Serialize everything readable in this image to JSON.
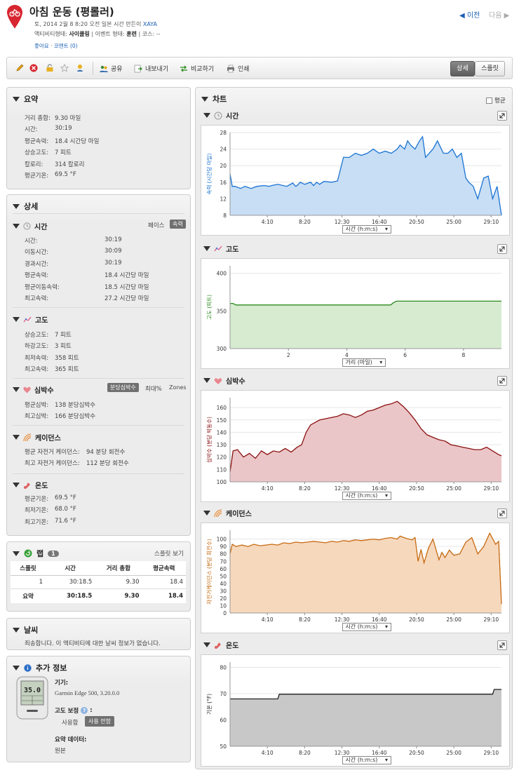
{
  "header": {
    "title": "아침 운동 (평롤러)",
    "date_line": "토, 2014 2월 8 8:20 오전 일본 시간 만든이",
    "author": "XAYA",
    "activity_type_label": "액티비티형태:",
    "activity_type": "사이클링",
    "event_type_label": "이벤트 형태:",
    "event_type": "훈련",
    "course_label": "코스:",
    "course": "--",
    "like": "좋아요",
    "comment": "코멘트 (0)",
    "prev": "이전",
    "next": "다음"
  },
  "toolbar": {
    "share": "공유",
    "export": "내보내기",
    "compare": "비교하기",
    "print": "인쇄",
    "detail": "상세",
    "split": "스플릿"
  },
  "summary": {
    "title": "요약",
    "rows": [
      {
        "label": "거리 총합:",
        "value": "9.30 마일"
      },
      {
        "label": "시간:",
        "value": "30:19"
      },
      {
        "label": "평균속력:",
        "value": "18.4 시간당 마일"
      },
      {
        "label": "상승고도:",
        "value": "7 피트"
      },
      {
        "label": "칼로리:",
        "value": "314 칼로리"
      },
      {
        "label": "평균기온:",
        "value": "69.5 °F"
      }
    ]
  },
  "details": {
    "title": "상세",
    "time": {
      "title": "시간",
      "pace": "페이스",
      "speed": "속력",
      "rows": [
        {
          "label": "시간:",
          "value": "30:19"
        },
        {
          "label": "이동시간:",
          "value": "30:09"
        },
        {
          "label": "경과시간:",
          "value": "30:19"
        },
        {
          "label": "평균속력:",
          "value": "18.4 시간당 마일"
        },
        {
          "label": "평균이동속력:",
          "value": "18.5 시간당 마일"
        },
        {
          "label": "최고속력:",
          "value": "27.2 시간당 마일"
        }
      ]
    },
    "elev": {
      "title": "고도",
      "rows": [
        {
          "label": "상승고도:",
          "value": "7 피트"
        },
        {
          "label": "하강고도:",
          "value": "3 피트"
        },
        {
          "label": "최저속력:",
          "value": "358 피트"
        },
        {
          "label": "최고속력:",
          "value": "365 피트"
        }
      ]
    },
    "hr": {
      "title": "심박수",
      "bpm": "분당심박수",
      "max": "최대%",
      "zones": "Zones",
      "rows": [
        {
          "label": "평균심박:",
          "value": "138 분당심박수"
        },
        {
          "label": "최고심박:",
          "value": "166 분당심박수"
        }
      ]
    },
    "cad": {
      "title": "케이던스",
      "rows": [
        {
          "label": "평균 자전거 케이던스:",
          "value": "94 분당 회전수"
        },
        {
          "label": "최고 자전거 케이던스:",
          "value": "112 분당 회전수"
        }
      ]
    },
    "temp": {
      "title": "온도",
      "rows": [
        {
          "label": "평균기온:",
          "value": "69.5 °F"
        },
        {
          "label": "최저기온:",
          "value": "68.0 °F"
        },
        {
          "label": "최고기온:",
          "value": "71.6 °F"
        }
      ]
    }
  },
  "laps": {
    "title": "랩",
    "count": "1",
    "split_view": "스플릿 보기",
    "headers": [
      "스플릿",
      "시간",
      "거리 총합",
      "평균속력"
    ],
    "rows": [
      [
        "1",
        "30:18.5",
        "9.30",
        "18.4"
      ]
    ],
    "total": [
      "요약",
      "30:18.5",
      "9.30",
      "18.4"
    ]
  },
  "weather": {
    "title": "날씨",
    "text": "죄송합니다. 이 액티비티에 대한 날씨 정보가 없습니다."
  },
  "extra": {
    "title": "추가 정보",
    "device_label": "기기:",
    "device": "Garmin Edge 500, 3.20.0.0",
    "elev_corr": "고도 보정",
    "use": "사용함",
    "nouse": "사용 안함",
    "summary_data": "요약 데이터:",
    "original": "원본",
    "device_screen": "35.0"
  },
  "charts": {
    "title": "차트",
    "avg": "평균"
  },
  "chart_data": [
    {
      "type": "line",
      "title": "시간",
      "ylabel": "속력 (시간당 마일)",
      "xlabel_select": "시간 (h:m:s)",
      "x_ticks": [
        "4:10",
        "8:20",
        "12:30",
        "16:40",
        "20:50",
        "25:00",
        "29:10"
      ],
      "y_ticks": [
        8,
        12,
        16,
        20,
        24,
        28
      ],
      "ylim": [
        8,
        28
      ],
      "xlim": [
        0,
        1819
      ],
      "x": [
        0,
        15,
        35,
        70,
        100,
        140,
        180,
        230,
        260,
        280,
        320,
        380,
        420,
        440,
        450,
        470,
        500,
        540,
        560,
        580,
        600,
        630,
        680,
        720,
        760,
        800,
        840,
        880,
        920,
        960,
        1000,
        1040,
        1080,
        1120,
        1140,
        1170,
        1190,
        1210,
        1240,
        1270,
        1290,
        1310,
        1360,
        1390,
        1430,
        1460,
        1490,
        1520,
        1550,
        1580,
        1600,
        1630,
        1660,
        1700,
        1730,
        1760,
        1790,
        1819
      ],
      "values": [
        18,
        15,
        15,
        14.5,
        15,
        14.5,
        15,
        15.2,
        15,
        15.2,
        15.5,
        15,
        15.8,
        15,
        15.2,
        16,
        15.5,
        16,
        15.2,
        16,
        15.5,
        16.2,
        16,
        16.3,
        22,
        22,
        23,
        22.5,
        23,
        24,
        23,
        23.5,
        23,
        24,
        25,
        24,
        26,
        25,
        24,
        26,
        27,
        22,
        24,
        26,
        23,
        23,
        24,
        22,
        23,
        17,
        16,
        15,
        12,
        17,
        17.5,
        12,
        15,
        8
      ],
      "grid": true,
      "color": "#1a73d2",
      "fill": "#c7def5"
    },
    {
      "type": "line",
      "title": "고도",
      "ylabel": "고도 (피트)",
      "xlabel_select": "거리 (마일)",
      "x_ticks": [
        "2",
        "4",
        "6",
        "8"
      ],
      "y_ticks": [
        300,
        350,
        400
      ],
      "ylim": [
        300,
        410
      ],
      "xlim": [
        0,
        9.3
      ],
      "x": [
        0,
        0.1,
        0.2,
        0.3,
        1,
        2,
        3,
        4,
        5,
        5.5,
        5.6,
        5.7,
        6,
        7,
        8,
        9.3
      ],
      "values": [
        360,
        360,
        358,
        358,
        358,
        358,
        358,
        358,
        358,
        358,
        361,
        363,
        363,
        363,
        363,
        363
      ],
      "grid": true,
      "color": "#2b8a1e",
      "fill": "#d6ebcf"
    },
    {
      "type": "line",
      "title": "심박수",
      "ylabel": "심박수 (분당 박동수)",
      "xlabel_select": "시간 (h:m:s)",
      "x_ticks": [
        "4:10",
        "8:20",
        "12:30",
        "16:40",
        "20:50",
        "25:00",
        "29:10"
      ],
      "y_ticks": [
        100,
        110,
        120,
        130,
        140,
        150,
        160
      ],
      "ylim": [
        100,
        168
      ],
      "xlim": [
        0,
        1819
      ],
      "x": [
        0,
        20,
        50,
        90,
        130,
        170,
        210,
        250,
        290,
        330,
        370,
        410,
        450,
        480,
        510,
        540,
        570,
        600,
        640,
        680,
        720,
        760,
        800,
        840,
        880,
        920,
        960,
        1000,
        1040,
        1080,
        1120,
        1160,
        1200,
        1240,
        1280,
        1320,
        1360,
        1400,
        1440,
        1480,
        1520,
        1560,
        1600,
        1640,
        1680,
        1720,
        1760,
        1800,
        1819
      ],
      "values": [
        108,
        125,
        126,
        120,
        123,
        119,
        125,
        122,
        125,
        124,
        127,
        124,
        128,
        130,
        140,
        146,
        148,
        150,
        151,
        152,
        153,
        155,
        154,
        152,
        154,
        157,
        158,
        160,
        162,
        163,
        165,
        161,
        156,
        150,
        143,
        138,
        136,
        134,
        133,
        130,
        129,
        128,
        127,
        126,
        126,
        128,
        125,
        122,
        121
      ],
      "grid": true,
      "color": "#8a1010",
      "fill": "#ebc6c8"
    },
    {
      "type": "line",
      "title": "케이던스",
      "ylabel": "자전거케이던스 (분당 회전수)",
      "xlabel_select": "시간 (h:m:s)",
      "x_ticks": [
        "4:10",
        "8:20",
        "12:30",
        "16:40",
        "20:50",
        "25:00",
        "29:10"
      ],
      "y_ticks": [
        0,
        10,
        20,
        30,
        40,
        50,
        60,
        70,
        80,
        90,
        100
      ],
      "ylim": [
        0,
        112
      ],
      "xlim": [
        0,
        1819
      ],
      "x": [
        0,
        15,
        40,
        80,
        120,
        160,
        200,
        240,
        280,
        320,
        360,
        400,
        440,
        480,
        520,
        560,
        600,
        640,
        680,
        720,
        760,
        800,
        840,
        880,
        920,
        960,
        1000,
        1040,
        1080,
        1120,
        1140,
        1180,
        1220,
        1240,
        1260,
        1280,
        1300,
        1330,
        1360,
        1400,
        1420,
        1440,
        1470,
        1500,
        1540,
        1580,
        1620,
        1660,
        1700,
        1740,
        1780,
        1800,
        1819
      ],
      "values": [
        80,
        93,
        90,
        92,
        90,
        93,
        91,
        92,
        93,
        92,
        95,
        94,
        96,
        95,
        96,
        97,
        96,
        95,
        97,
        96,
        98,
        97,
        99,
        98,
        99,
        100,
        99,
        101,
        102,
        100,
        104,
        101,
        99,
        102,
        70,
        86,
        68,
        88,
        100,
        72,
        82,
        75,
        85,
        78,
        80,
        96,
        102,
        80,
        90,
        108,
        93,
        97,
        12
      ],
      "grid": true,
      "color": "#c66a10",
      "fill": "#f6d8bd"
    },
    {
      "type": "line",
      "title": "온도",
      "ylabel": "기온 (°F)",
      "xlabel_select": "시간 (h:m:s)",
      "x_ticks": [
        "4:10",
        "8:20",
        "12:30",
        "16:40",
        "20:50",
        "25:00",
        "29:10"
      ],
      "y_ticks": [
        50,
        60,
        70,
        80
      ],
      "ylim": [
        50,
        82
      ],
      "xlim": [
        0,
        1819
      ],
      "x": [
        0,
        320,
        330,
        1760,
        1770,
        1819
      ],
      "values": [
        68,
        68,
        69.8,
        69.8,
        71.6,
        71.6
      ],
      "grid": true,
      "color": "#222222",
      "fill": "#c8c8c8"
    }
  ]
}
